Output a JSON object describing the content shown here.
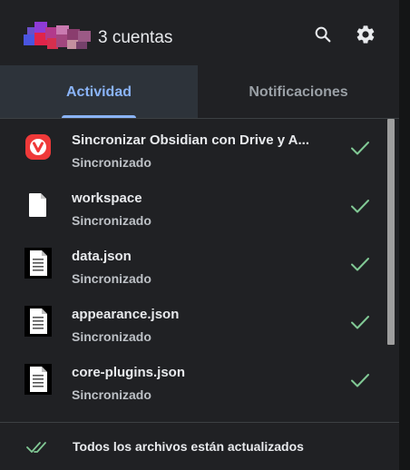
{
  "header": {
    "accounts_label": "3 cuentas",
    "search_icon": "search-icon",
    "settings_icon": "gear-icon"
  },
  "tabs": [
    {
      "label": "Actividad",
      "active": true
    },
    {
      "label": "Notificaciones",
      "active": false
    }
  ],
  "files": [
    {
      "name": "Sincronizar Obsidian con Drive y A...",
      "status": "Sincronizado",
      "icon": "vivaldi-icon"
    },
    {
      "name": "workspace",
      "status": "Sincronizado",
      "icon": "file-icon"
    },
    {
      "name": "data.json",
      "status": "Sincronizado",
      "icon": "text-document-icon"
    },
    {
      "name": "appearance.json",
      "status": "Sincronizado",
      "icon": "text-document-icon"
    },
    {
      "name": "core-plugins.json",
      "status": "Sincronizado",
      "icon": "text-document-icon"
    }
  ],
  "footer": {
    "status_text": "Todos los archivos están actualizados",
    "icon": "double-check-icon"
  },
  "colors": {
    "background": "#202124",
    "accent": "#8ab4f8",
    "success": "#81c995",
    "vivaldi_red": "#ef3939"
  }
}
